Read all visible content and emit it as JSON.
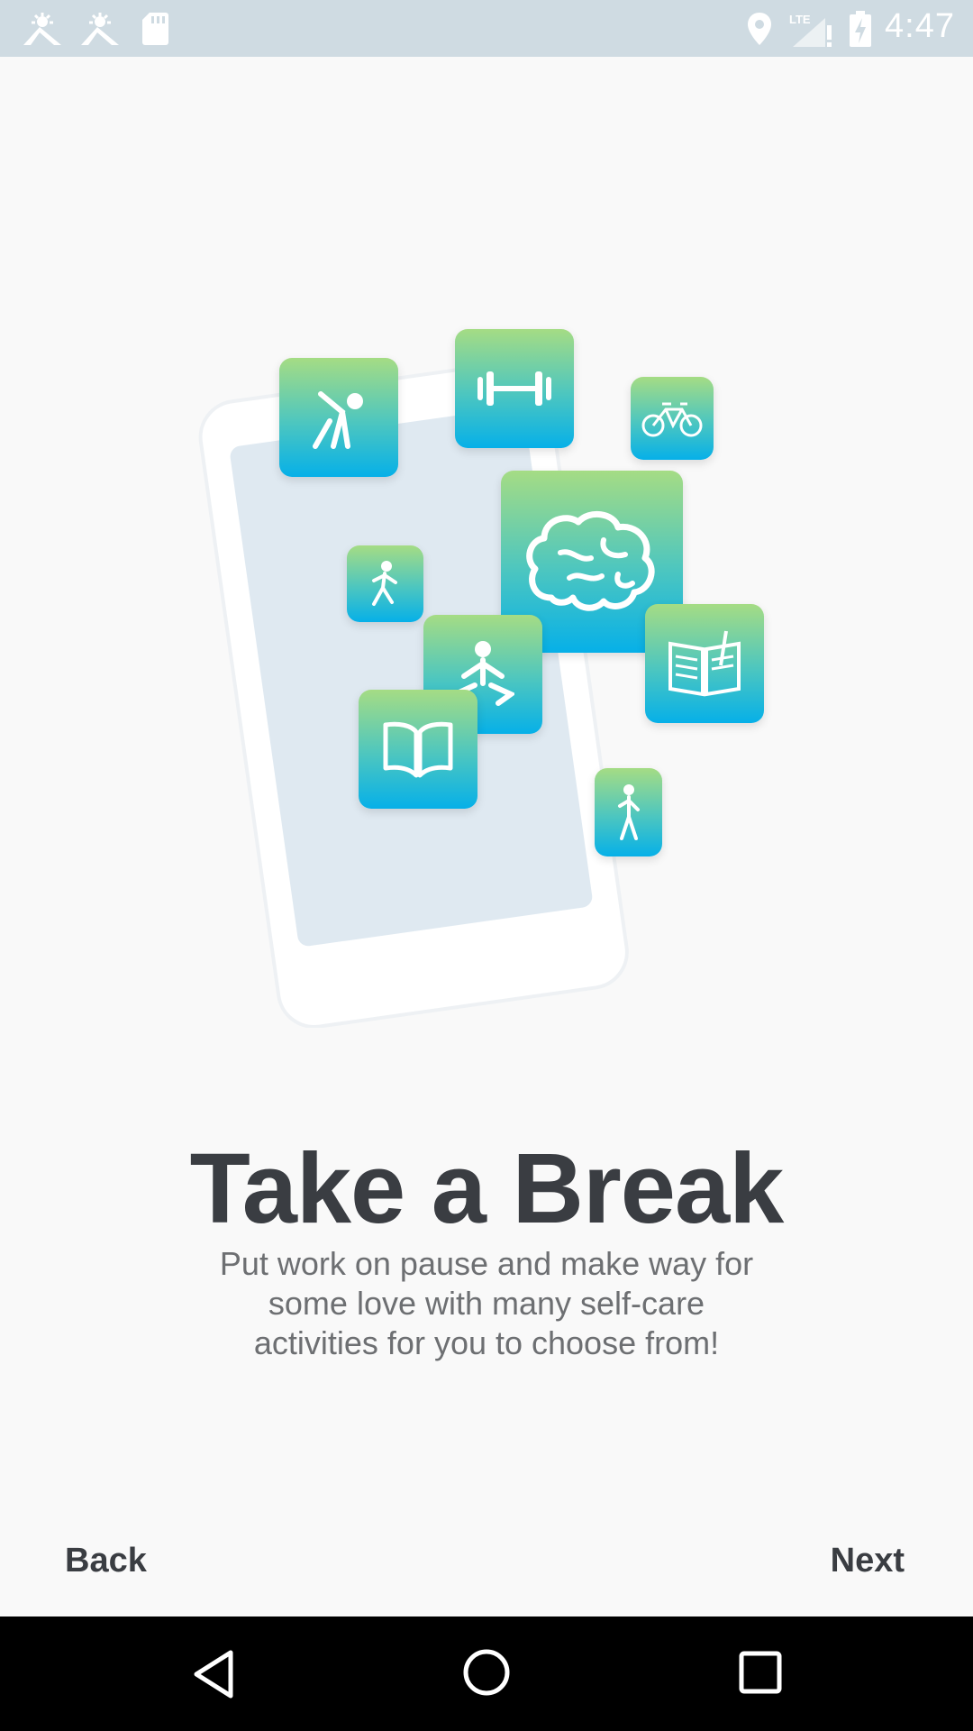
{
  "status_bar": {
    "time": "4:47",
    "network": "LTE",
    "icons": [
      "weather-icon",
      "weather-icon",
      "sd-card-icon",
      "location-icon",
      "signal-icon",
      "battery-charging-icon"
    ]
  },
  "illustration": {
    "tiles": [
      "stretching-icon",
      "dumbbell-icon",
      "bicycle-icon",
      "brain-icon",
      "running-icon",
      "meditation-icon",
      "journal-icon",
      "book-icon",
      "walking-icon"
    ]
  },
  "onboarding": {
    "title": "Take a Break",
    "subtitle_line1": "Put work on pause and make way for",
    "subtitle_line2": "some love with many self-care",
    "subtitle_line3": "activities for you to choose from!"
  },
  "navigation": {
    "back_label": "Back",
    "next_label": "Next"
  },
  "system_nav": [
    "back-triangle-icon",
    "home-circle-icon",
    "recents-square-icon"
  ],
  "colors": {
    "background": "#f9f9f9",
    "status_bar": "#cfdbe2",
    "title": "#3a3d42",
    "subtitle": "#6d6f72",
    "tile_gradient_top": "#a5dc84",
    "tile_gradient_bottom": "#06b0e8"
  }
}
